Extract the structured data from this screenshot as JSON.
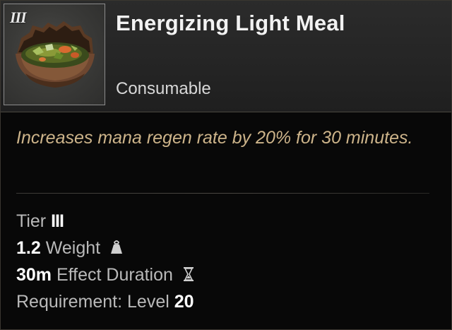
{
  "item": {
    "tier_badge": "III",
    "name": "Energizing Light Meal",
    "type": "Consumable",
    "icon": "food-bowl-icon",
    "description": "Increases mana regen rate by 20% for 30 minutes."
  },
  "stats": {
    "tier_label": "Tier",
    "tier_value": "III",
    "weight_value": "1.2",
    "weight_label": "Weight",
    "weight_icon": "weight-icon",
    "duration_value": "30m",
    "duration_label": "Effect Duration",
    "duration_icon": "hourglass-icon",
    "requirement_label": "Requirement: Level",
    "requirement_value": "20"
  },
  "colors": {
    "description": "#cdb48a",
    "header_bg": "#2b2b2b",
    "body_bg": "#080808"
  }
}
